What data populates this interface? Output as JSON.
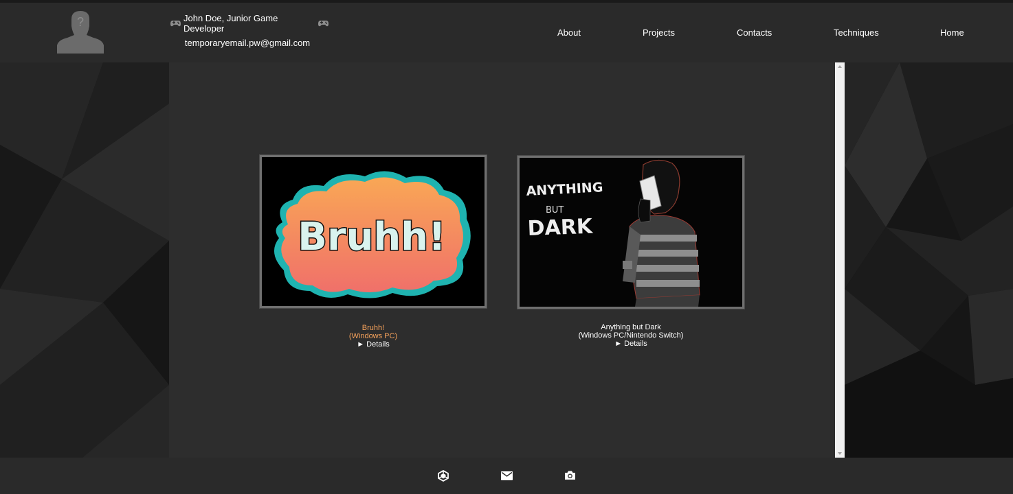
{
  "header": {
    "name_line": "John Doe, Junior Game Developer",
    "email": "temporaryemail.pw@gmail.com"
  },
  "nav": {
    "items": [
      {
        "label": "About"
      },
      {
        "label": "Projects"
      },
      {
        "label": "Contacts"
      },
      {
        "label": "Techniques"
      },
      {
        "label": "Home"
      }
    ]
  },
  "projects": [
    {
      "title": "Bruhh!",
      "platform": "(Windows PC)",
      "details": "► Details",
      "thumbnail_text": "Bruhh!",
      "accent_color": "#f7a35c"
    },
    {
      "title": "Anything but Dark",
      "platform": "(Windows PC/Nintendo Switch)",
      "details": "► Details",
      "thumbnail_text_line1": "ANYTHING",
      "thumbnail_text_line2": "BUT",
      "thumbnail_text_line3": "DARK",
      "accent_color": "#ffffff"
    }
  ],
  "footer": {
    "icons": [
      "unity-icon",
      "mail-icon",
      "camera-icon"
    ]
  },
  "colors": {
    "header_bg": "#2a2a2a",
    "main_bg": "#2d2d2d",
    "text": "#ffffff",
    "highlight": "#f7a35c"
  }
}
